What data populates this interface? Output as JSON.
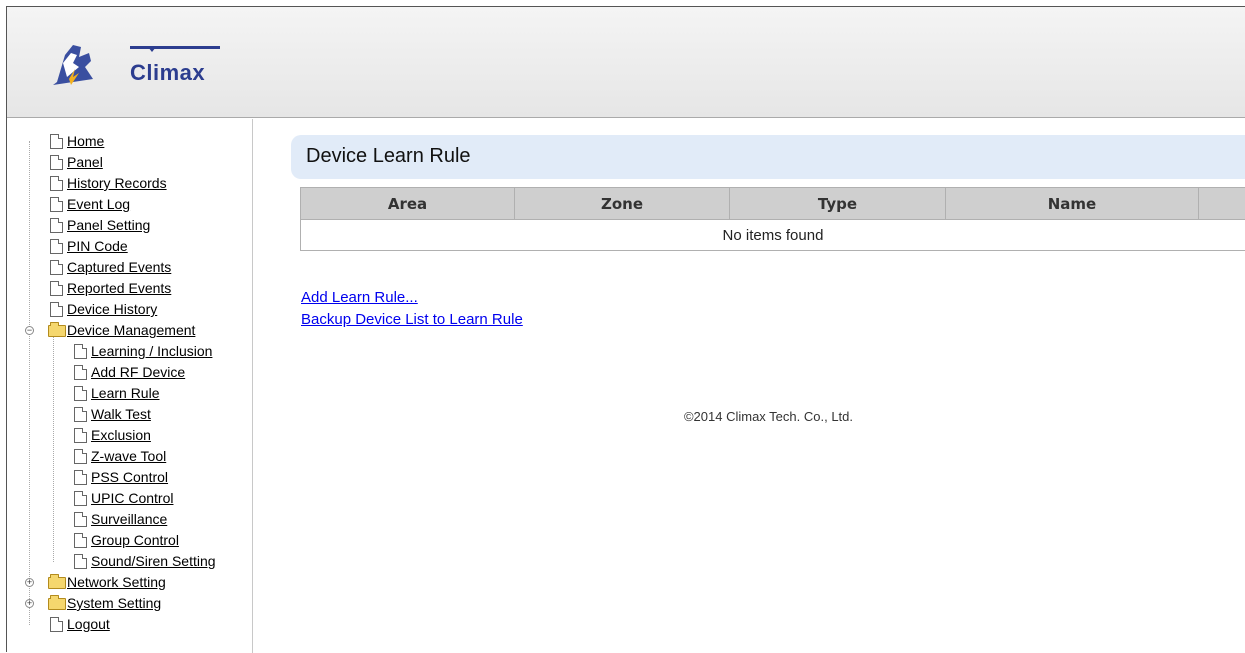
{
  "brand": {
    "logo_text": "Climax"
  },
  "nav": {
    "items": [
      {
        "label": "Home",
        "icon": "file-icon",
        "level": 0
      },
      {
        "label": "Panel",
        "icon": "file-icon",
        "level": 0
      },
      {
        "label": "History Records",
        "icon": "file-icon",
        "level": 0
      },
      {
        "label": "Event Log",
        "icon": "file-icon",
        "level": 0
      },
      {
        "label": "Panel Setting",
        "icon": "file-icon",
        "level": 0
      },
      {
        "label": "PIN Code",
        "icon": "file-icon",
        "level": 0
      },
      {
        "label": "Captured Events",
        "icon": "file-icon",
        "level": 0
      },
      {
        "label": "Reported Events",
        "icon": "file-icon",
        "level": 0
      },
      {
        "label": "Device History",
        "icon": "file-icon",
        "level": 0
      },
      {
        "label": "Device Management",
        "icon": "folder-open-icon",
        "level": 0,
        "toggle": "−"
      },
      {
        "label": "Learning / Inclusion",
        "icon": "file-icon",
        "level": 1
      },
      {
        "label": "Add RF Device",
        "icon": "file-icon",
        "level": 1
      },
      {
        "label": "Learn Rule",
        "icon": "file-icon",
        "level": 1
      },
      {
        "label": "Walk Test",
        "icon": "file-icon",
        "level": 1
      },
      {
        "label": "Exclusion",
        "icon": "file-icon",
        "level": 1
      },
      {
        "label": "Z-wave Tool",
        "icon": "file-icon",
        "level": 1
      },
      {
        "label": "PSS Control",
        "icon": "file-icon",
        "level": 1
      },
      {
        "label": "UPIC Control",
        "icon": "file-icon",
        "level": 1
      },
      {
        "label": "Surveillance",
        "icon": "file-icon",
        "level": 1
      },
      {
        "label": "Group Control",
        "icon": "file-icon",
        "level": 1
      },
      {
        "label": "Sound/Siren Setting",
        "icon": "file-icon",
        "level": 1
      },
      {
        "label": "Network Setting",
        "icon": "folder-icon",
        "level": 0,
        "toggle": "+"
      },
      {
        "label": "System Setting",
        "icon": "folder-icon",
        "level": 0,
        "toggle": "+"
      },
      {
        "label": "Logout",
        "icon": "file-icon",
        "level": 0
      }
    ]
  },
  "main": {
    "title": "Device Learn Rule",
    "table": {
      "columns": [
        "Area",
        "Zone",
        "Type",
        "Name",
        ""
      ],
      "empty_message": "No items found"
    },
    "links": {
      "add": "Add Learn Rule...",
      "backup": "Backup Device List to Learn Rule"
    },
    "copyright": "©2014 Climax Tech. Co., Ltd."
  },
  "colors": {
    "title_bg": "#e1ebf8",
    "header_bg": "#cfcfcf",
    "link": "#0000ee",
    "logo": "#2c3d8f"
  }
}
